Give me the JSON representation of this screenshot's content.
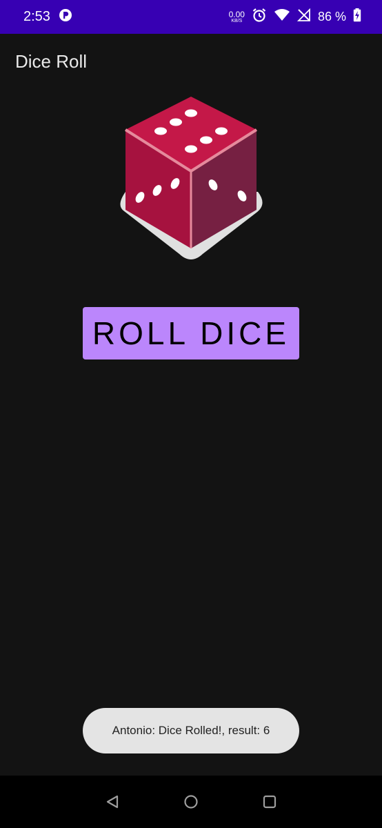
{
  "status_bar": {
    "time": "2:53",
    "net_speed_value": "0.00",
    "net_speed_unit": "KB/S",
    "battery_percent": "86 %",
    "icons": [
      "app-p-icon",
      "alarm-icon",
      "wifi-icon",
      "no-signal-icon",
      "battery-charging-icon"
    ]
  },
  "app": {
    "title": "Dice Roll"
  },
  "dice": {
    "image_name": "dice-icon",
    "colors": {
      "left": "#a6123f",
      "right": "#7a1e45",
      "top": "#c41848",
      "edge": "#e58a9c",
      "shadow": "#e0e0e0"
    }
  },
  "roll_button": {
    "label": "ROLL DICE",
    "color": "#bb86fc"
  },
  "toast": {
    "message": "Antonio: Dice Rolled!, result: 6"
  },
  "nav_bar": {
    "buttons": [
      "back-icon",
      "home-icon",
      "recents-icon"
    ]
  },
  "colors": {
    "status_bar": "#3700b3",
    "background": "#131313"
  }
}
